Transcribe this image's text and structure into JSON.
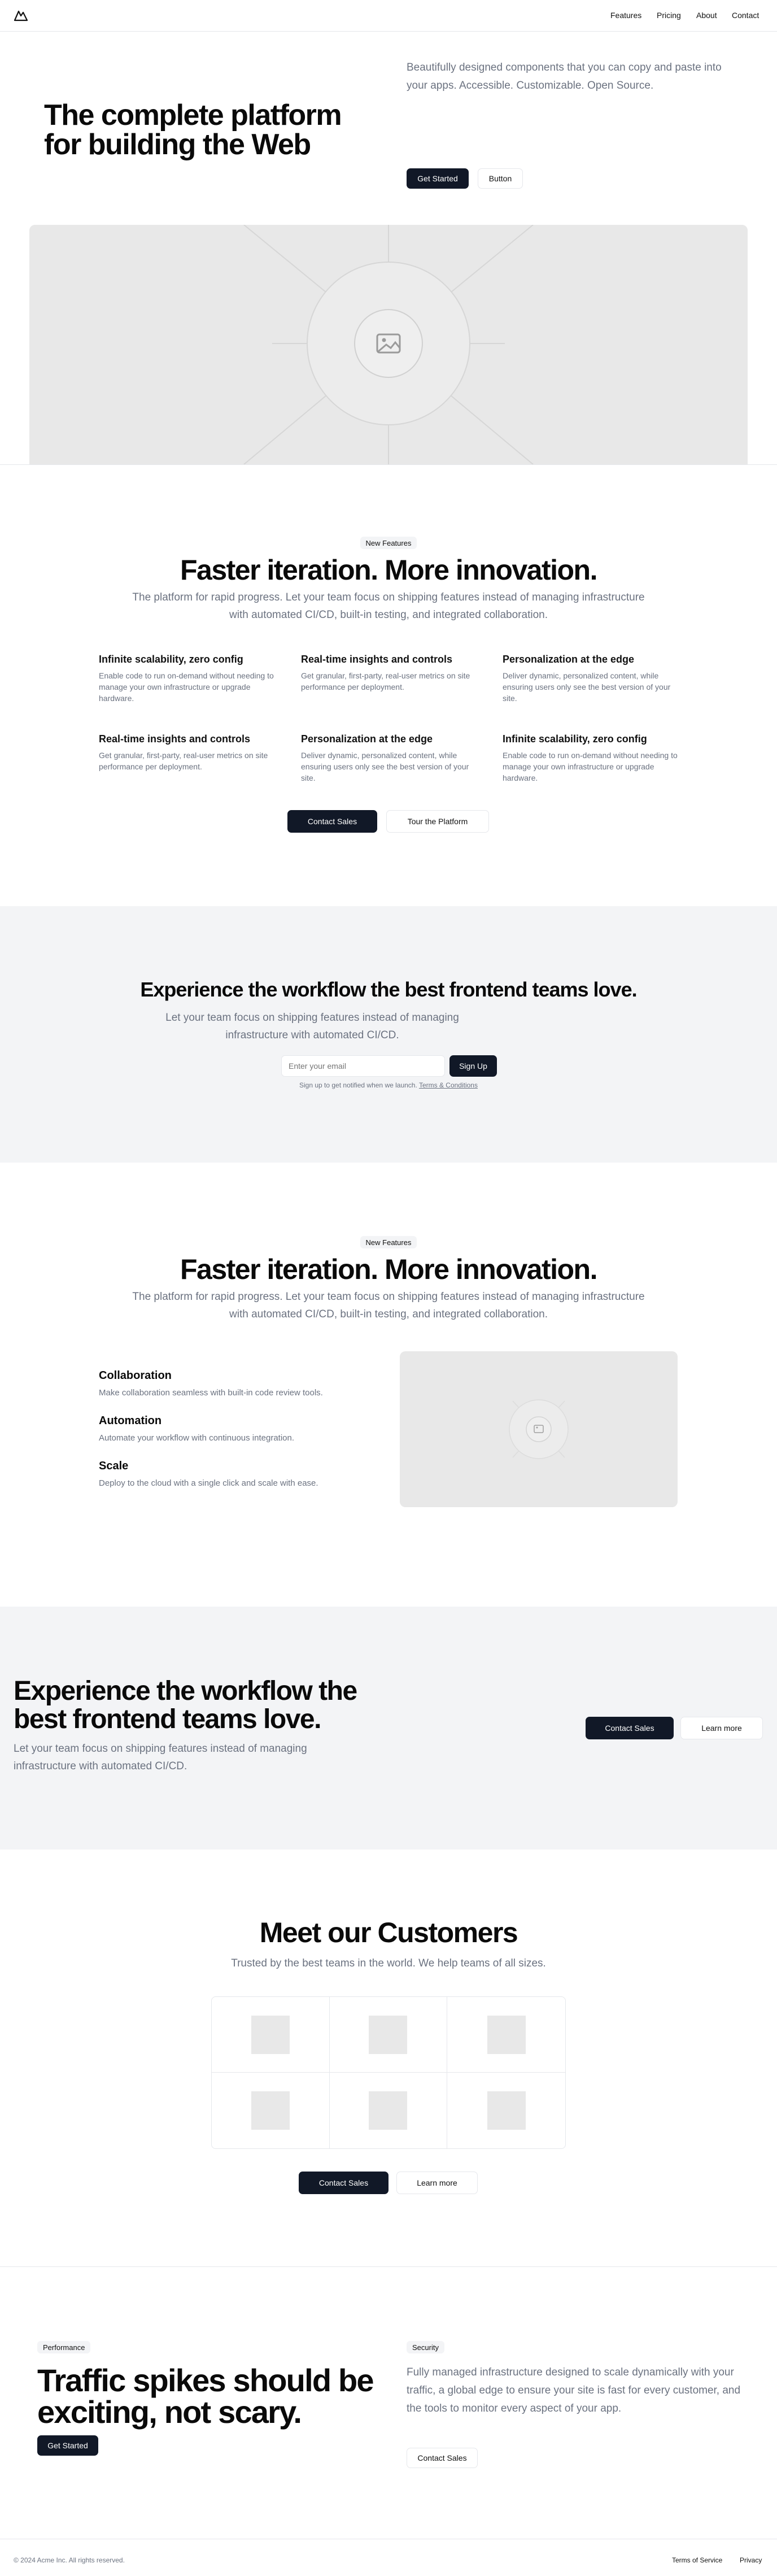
{
  "nav": {
    "logo_name": "triangle-logo",
    "links": [
      "Features",
      "Pricing",
      "About",
      "Contact"
    ]
  },
  "hero": {
    "title": "The complete platform for building the Web",
    "description": "Beautifully designed components that you can copy and paste into your apps. Accessible. Customizable. Open Source.",
    "primary_button": "Get Started",
    "secondary_button": "Button"
  },
  "features1": {
    "badge": "New Features",
    "title": "Faster iteration. More innovation.",
    "subtitle": "The platform for rapid progress. Let your team focus on shipping features instead of managing infrastructure with automated CI/CD, built-in testing, and integrated collaboration.",
    "items": [
      {
        "title": "Infinite scalability, zero config",
        "desc": "Enable code to run on-demand without needing to manage your own infrastructure or upgrade hardware."
      },
      {
        "title": "Real-time insights and controls",
        "desc": "Get granular, first-party, real-user metrics on site performance per deployment."
      },
      {
        "title": "Personalization at the edge",
        "desc": "Deliver dynamic, personalized content, while ensuring users only see the best version of your site."
      },
      {
        "title": "Real-time insights and controls",
        "desc": "Get granular, first-party, real-user metrics on site performance per deployment."
      },
      {
        "title": "Personalization at the edge",
        "desc": "Deliver dynamic, personalized content, while ensuring users only see the best version of your site."
      },
      {
        "title": "Infinite scalability, zero config",
        "desc": "Enable code to run on-demand without needing to manage your own infrastructure or upgrade hardware."
      }
    ],
    "primary_button": "Contact Sales",
    "secondary_button": "Tour the Platform"
  },
  "signup": {
    "title": "Experience the workflow the best frontend teams love.",
    "subtitle": "Let your team focus on shipping features instead of managing infrastructure with automated CI/CD.",
    "email_placeholder": "Enter your email",
    "button": "Sign Up",
    "note": "Sign up to get notified when we launch.",
    "terms_link": "Terms & Conditions"
  },
  "features2": {
    "badge": "New Features",
    "title": "Faster iteration. More innovation.",
    "subtitle": "The platform for rapid progress. Let your team focus on shipping features instead of managing infrastructure with automated CI/CD, built-in testing, and integrated collaboration.",
    "items": [
      {
        "title": "Collaboration",
        "desc": "Make collaboration seamless with built-in code review tools."
      },
      {
        "title": "Automation",
        "desc": "Automate your workflow with continuous integration."
      },
      {
        "title": "Scale",
        "desc": "Deploy to the cloud with a single click and scale with ease."
      }
    ]
  },
  "cta": {
    "title": "Experience the workflow the best frontend teams love.",
    "subtitle": "Let your team focus on shipping features instead of managing infrastructure with automated CI/CD.",
    "primary_button": "Contact Sales",
    "secondary_button": "Learn more"
  },
  "customers": {
    "title": "Meet our Customers",
    "subtitle": "Trusted by the best teams in the world. We help teams of all sizes.",
    "primary_button": "Contact Sales",
    "secondary_button": "Learn more"
  },
  "performance": {
    "badge": "Performance",
    "title": "Traffic spikes should be exciting, not scary.",
    "button": "Get Started",
    "badge_right": "Security",
    "description": "Fully managed infrastructure designed to scale dynamically with your traffic, a global edge to ensure your site is fast for every customer, and the tools to monitor every aspect of your app.",
    "button_right": "Contact Sales"
  },
  "footer": {
    "copyright": "© 2024 Acme Inc. All rights reserved.",
    "links": [
      "Terms of Service",
      "Privacy"
    ]
  },
  "colors": {
    "dark": "#111827",
    "muted": "#6b7280",
    "placeholder_bg": "#e8e8e8",
    "section_bg": "#f3f4f6"
  }
}
